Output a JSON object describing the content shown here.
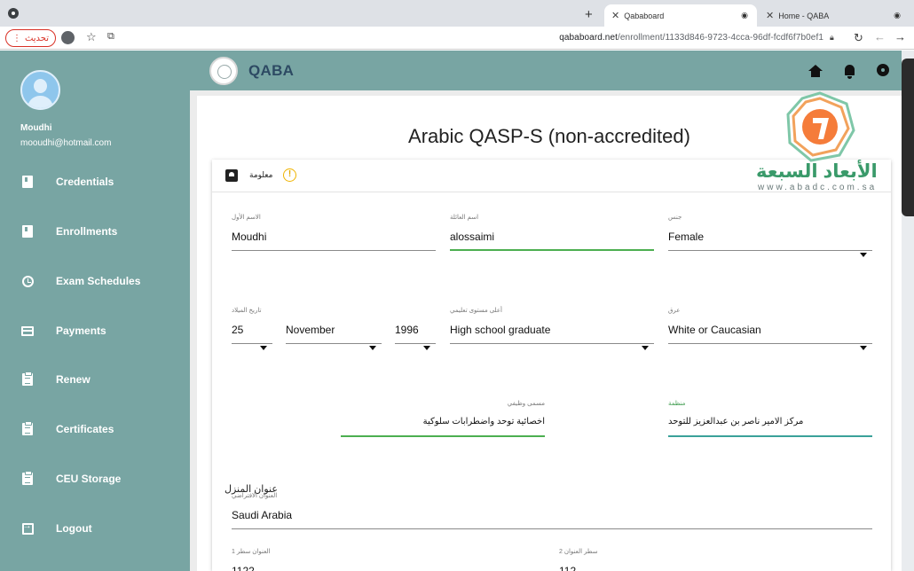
{
  "browser": {
    "tabs": [
      {
        "title": "Qababoard",
        "active": true
      },
      {
        "title": "Home - QABA",
        "active": false
      }
    ],
    "update_label": "تحديث",
    "url_domain": "qababoard.net",
    "url_path": "/enrollment/1133d846-9723-4cca-96df-fcdf6f7b0ef1"
  },
  "sidebar": {
    "user_name": "Moudhi",
    "user_email": "mooudhi@hotmail.com",
    "items": [
      {
        "label": "Credentials",
        "icon": "document-icon"
      },
      {
        "label": "Enrollments",
        "icon": "document-icon"
      },
      {
        "label": "Exam Schedules",
        "icon": "clock-icon"
      },
      {
        "label": "Payments",
        "icon": "credit-card-icon"
      },
      {
        "label": "Renew",
        "icon": "clipboard-icon"
      },
      {
        "label": "Certificates",
        "icon": "clipboard-icon"
      },
      {
        "label": "CEU Storage",
        "icon": "clipboard-icon"
      },
      {
        "label": "Logout",
        "icon": "exit-icon"
      }
    ]
  },
  "appbar": {
    "title": "QABA"
  },
  "page": {
    "title": "Arabic QASP-S (non-accredited)"
  },
  "card": {
    "header_label": "معلومة",
    "warning_symbol": "!"
  },
  "form": {
    "first_name": {
      "label": "الاسم الأول",
      "value": "Moudhi"
    },
    "family_name": {
      "label": "اسم العائلة",
      "value": "alossaimi"
    },
    "gender": {
      "label": "جنس",
      "value": "Female"
    },
    "birth_date": {
      "label": "تاريخ الميلاد",
      "day": "25",
      "month": "November",
      "year": "1996"
    },
    "education": {
      "label": "أعلى مستوى تعليمي",
      "value": "High school graduate"
    },
    "race": {
      "label": "عرق",
      "value": "White or Caucasian"
    },
    "job_title": {
      "label": "مسمى وظيفي",
      "value": "اخصائية توحد واضطرابات سلوكية"
    },
    "organization": {
      "label": "منظمة",
      "value": "مركز الامير ناصر بن عبدالعزيز للتوحد"
    },
    "home_address_heading": "عنوان المنزل",
    "default_address": {
      "label": "العنوان الافتراضي",
      "value": "Saudi Arabia"
    },
    "address_line1": {
      "label": "العنوان سطر 1",
      "value": "1122"
    },
    "address_line2": {
      "label": "سطر العنوان 2",
      "value": "112"
    }
  },
  "watermark": {
    "arabic": "الأبعاد السبعة",
    "url": "www.abadc.com.sa"
  },
  "colors": {
    "sidebar": "#78a5a3",
    "title_text": "#2d4a63",
    "focus_green": "#4caf50",
    "focus_teal": "#3aa19a",
    "warning": "#f0b400"
  }
}
